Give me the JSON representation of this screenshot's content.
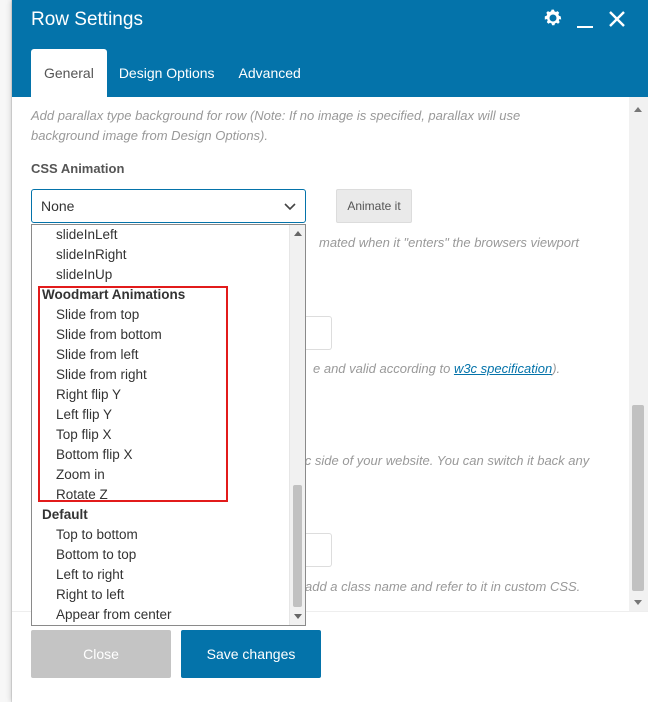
{
  "window": {
    "title": "Row Settings"
  },
  "tabs": [
    {
      "label": "General",
      "active": true
    },
    {
      "label": "Design Options",
      "active": false
    },
    {
      "label": "Advanced",
      "active": false
    }
  ],
  "body": {
    "parallax_help_line1": "Add parallax type background for row (Note: If no image is specified, parallax will use",
    "parallax_help_line2": "background image from Design Options).",
    "css_animation": {
      "label": "CSS Animation",
      "selected": "None",
      "animate_button": "Animate it",
      "help_fragment": "mated when it \"enters\" the browsers viewport"
    },
    "id_help": {
      "fragment": "e and valid according to",
      "link": "w3c specification",
      "tail": ")."
    },
    "public_help_fragment": "lic side of your website. You can switch it back any",
    "class_help_fragment": "add a class name and refer to it in custom CSS."
  },
  "dropdown": {
    "items_before": [
      "slideInLeft",
      "slideInRight",
      "slideInUp"
    ],
    "groups": [
      {
        "label": "Woodmart Animations",
        "items": [
          "Slide from top",
          "Slide from bottom",
          "Slide from left",
          "Slide from right",
          "Right flip Y",
          "Left flip Y",
          "Top flip X",
          "Bottom flip X",
          "Zoom in",
          "Rotate Z"
        ]
      },
      {
        "label": "Default",
        "items": [
          "Top to bottom",
          "Bottom to top",
          "Left to right",
          "Right to left",
          "Appear from center"
        ]
      }
    ]
  },
  "footer": {
    "close_label": "Close",
    "save_label": "Save changes"
  },
  "colors": {
    "header": "#0473aa",
    "highlight": "#e21b1b"
  }
}
